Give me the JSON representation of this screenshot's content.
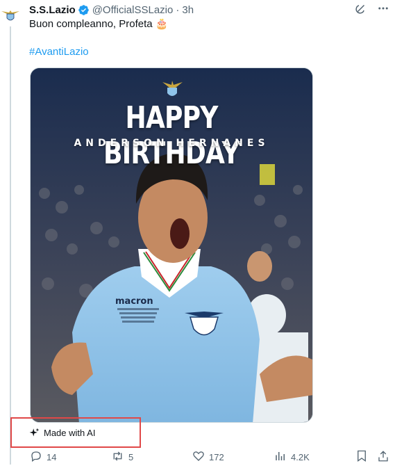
{
  "tweet": {
    "display_name": "S.S.Lazio",
    "handle": "@OfficialSSLazio",
    "separator": "·",
    "time": "3h",
    "text": "Buon compleanno, Profeta 🎂",
    "hashtag": "#AvantiLazio",
    "icons": {
      "avatar": "lazio-eagle-crest",
      "verified": "verified-badge-icon",
      "grok": "grok-icon",
      "more": "more-icon"
    },
    "colors": {
      "accent": "#1d9bf0",
      "muted": "#536471",
      "ai_highlight": "#e04848"
    }
  },
  "media": {
    "headline": "HAPPY BIRTHDAY",
    "subheadline": "ANDERSON HERNANES",
    "sponsor": "macron"
  },
  "ai_label": {
    "text": "Made with AI",
    "icon": "sparkle-icon"
  },
  "actions": {
    "reply": {
      "icon": "reply-icon",
      "count": "14"
    },
    "repost": {
      "icon": "repost-icon",
      "count": "5"
    },
    "like": {
      "icon": "heart-icon",
      "count": "172"
    },
    "views": {
      "icon": "views-icon",
      "count": "4.2K"
    },
    "bookmark": {
      "icon": "bookmark-icon"
    },
    "share": {
      "icon": "share-icon"
    }
  }
}
